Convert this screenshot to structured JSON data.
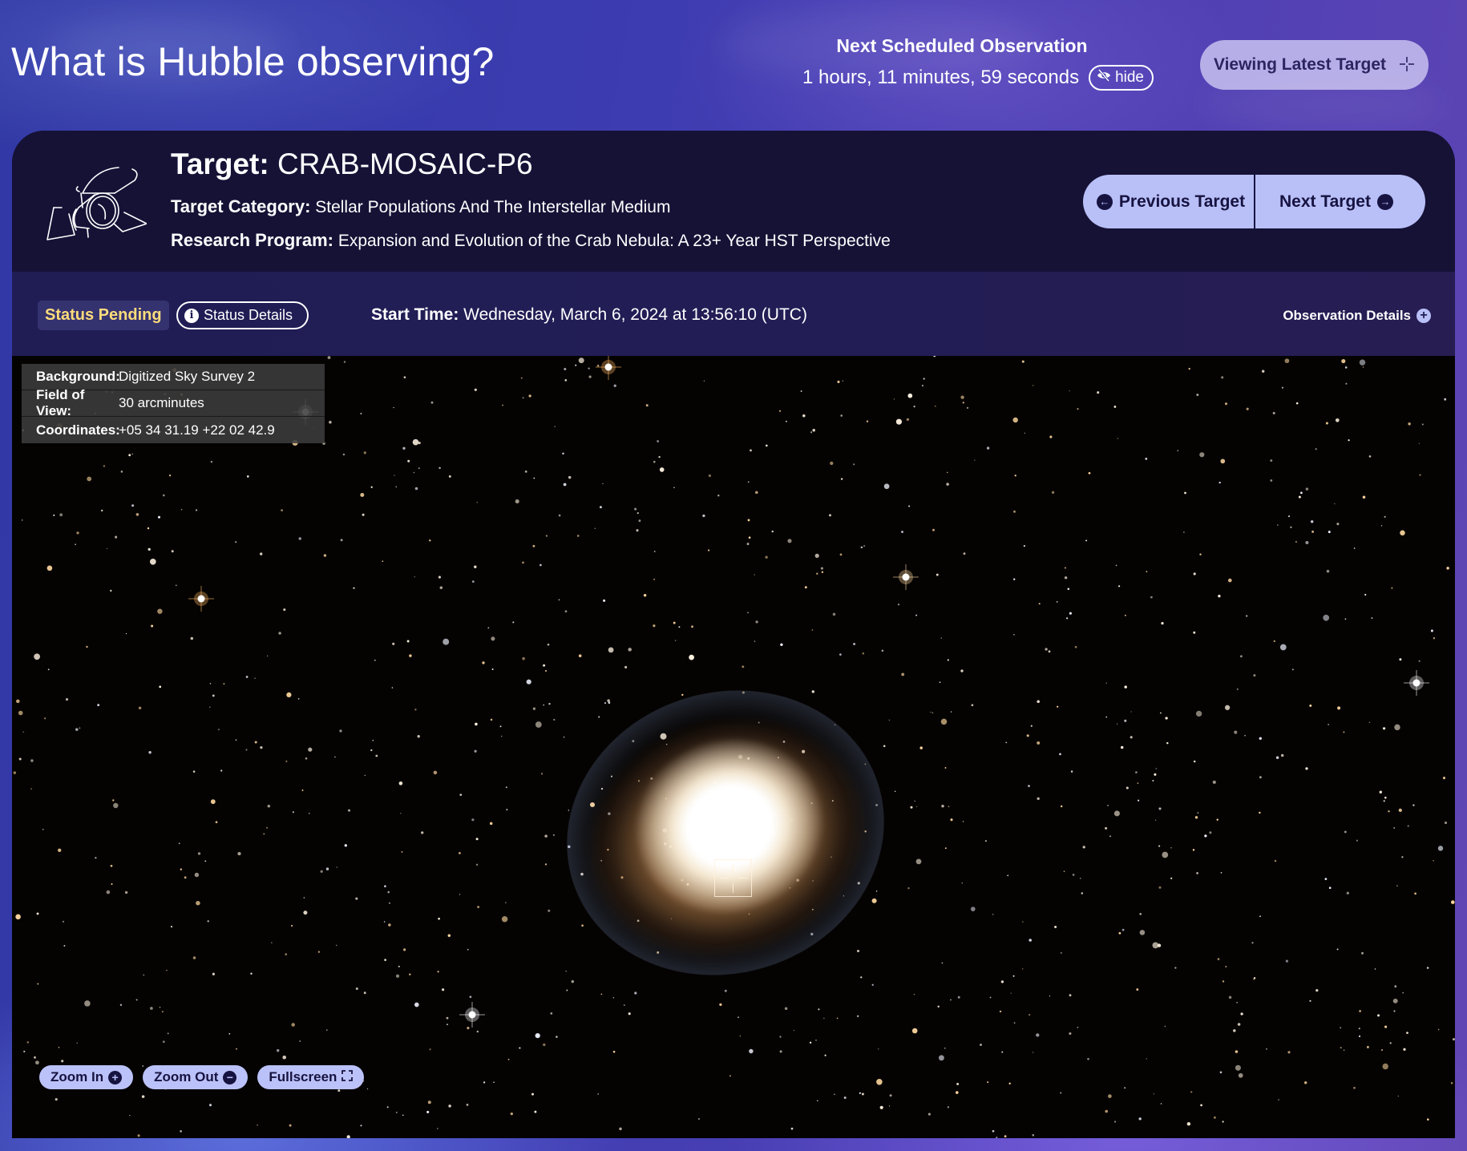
{
  "header": {
    "title": "What is Hubble observing?",
    "next_observation_label": "Next Scheduled Observation",
    "countdown": "1 hours, 11 minutes, 59 seconds",
    "hide_label": "hide",
    "viewing_button_label": "Viewing Latest Target",
    "viewing_button_icon": "crosshair-icon"
  },
  "target": {
    "name_label": "Target:",
    "name": "CRAB-MOSAIC-P6",
    "category_label": "Target Category:",
    "category": "Stellar Populations And The Interstellar Medium",
    "program_label": "Research Program:",
    "program": "Expansion and Evolution of the Crab Nebula: A 23+ Year HST Perspective"
  },
  "navigation": {
    "previous_label": "Previous Target",
    "next_label": "Next Target"
  },
  "status": {
    "badge": "Status Pending",
    "badge_color": "#fddc7a",
    "details_label": "Status Details",
    "start_time_label": "Start Time:",
    "start_time": "Wednesday, March 6, 2024 at 13:56:10 (UTC)",
    "observation_details_label": "Observation Details"
  },
  "image_info": [
    {
      "key": "Background:",
      "value": "Digitized Sky Survey 2"
    },
    {
      "key": "Field of View:",
      "value": "30 arcminutes"
    },
    {
      "key": "Coordinates:",
      "value": "+05 34 31.19 +22 02 42.9"
    }
  ],
  "image_controls": {
    "zoom_in_label": "Zoom In",
    "zoom_out_label": "Zoom Out",
    "fullscreen_label": "Fullscreen"
  },
  "colors": {
    "accent_button": "#b9c0f8",
    "card_bg": "#161236",
    "status_bar_bg": "#201d55"
  }
}
